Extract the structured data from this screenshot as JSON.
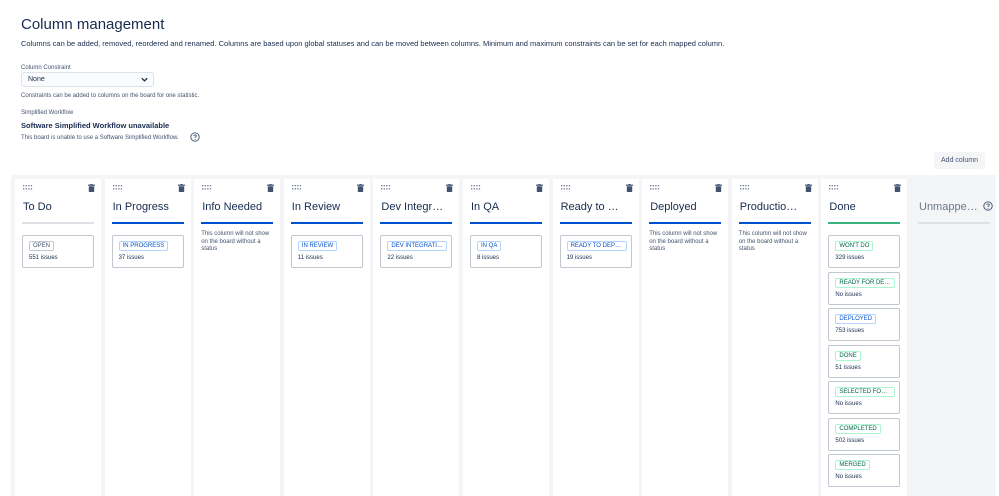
{
  "page": {
    "title": "Column management",
    "description": "Columns can be added, removed, reordered and renamed. Columns are based upon global statuses and can be moved between columns. Minimum and maximum constraints can be set for each mapped column."
  },
  "constraint": {
    "label": "Column Constraint",
    "value": "None",
    "help": "Constraints can be added to columns on the board for one statistic."
  },
  "workflow": {
    "label": "Simplified Workflow",
    "title": "Software Simplified Workflow unavailable",
    "help": "This board is unable to use a Software Simplified Workflow."
  },
  "toolbar": {
    "add_column": "Add column"
  },
  "no_status_text": "This column will not show on the board without a status",
  "columns": [
    {
      "name": "To Do",
      "bar": "grey",
      "cards": [
        {
          "status": "OPEN",
          "issues": "551 issues",
          "tone": "grey"
        }
      ]
    },
    {
      "name": "In Progress",
      "bar": "blue",
      "cards": [
        {
          "status": "IN PROGRESS",
          "issues": "37 issues",
          "tone": "blue"
        }
      ]
    },
    {
      "name": "Info Needed",
      "bar": "blue",
      "cards": []
    },
    {
      "name": "In Review",
      "bar": "blue",
      "cards": [
        {
          "status": "IN REVIEW",
          "issues": "11 issues",
          "tone": "blue"
        }
      ]
    },
    {
      "name": "Dev Integr…",
      "bar": "blue",
      "cards": [
        {
          "status": "DEV INTEGRATI…",
          "issues": "22 issues",
          "tone": "blue"
        }
      ]
    },
    {
      "name": "In QA",
      "bar": "blue",
      "cards": [
        {
          "status": "IN QA",
          "issues": "8 issues",
          "tone": "blue"
        }
      ]
    },
    {
      "name": "Ready to …",
      "bar": "blue",
      "cards": [
        {
          "status": "READY TO DEPL…",
          "issues": "19 issues",
          "tone": "blue"
        }
      ]
    },
    {
      "name": "Deployed",
      "bar": "blue",
      "cards": []
    },
    {
      "name": "Productio…",
      "bar": "blue",
      "cards": []
    },
    {
      "name": "Done",
      "bar": "green",
      "cards": [
        {
          "status": "WON'T DO",
          "issues": "329 issues",
          "tone": "green"
        },
        {
          "status": "READY FOR DEP…",
          "issues": "No issues",
          "tone": "green"
        },
        {
          "status": "DEPLOYED",
          "issues": "753 issues",
          "tone": "blue"
        },
        {
          "status": "DONE",
          "issues": "51 issues",
          "tone": "green"
        },
        {
          "status": "SELECTED FOR …",
          "issues": "No issues",
          "tone": "green"
        },
        {
          "status": "COMPLETED",
          "issues": "502 issues",
          "tone": "green"
        },
        {
          "status": "MERGED",
          "issues": "No issues",
          "tone": "green"
        }
      ]
    }
  ],
  "unmapped": {
    "name": "Unmappe…"
  },
  "icons": {
    "drag": "drag-handle-icon",
    "trash": "trash-icon",
    "help": "question-circle-icon",
    "chevron": "chevron-down-icon"
  }
}
